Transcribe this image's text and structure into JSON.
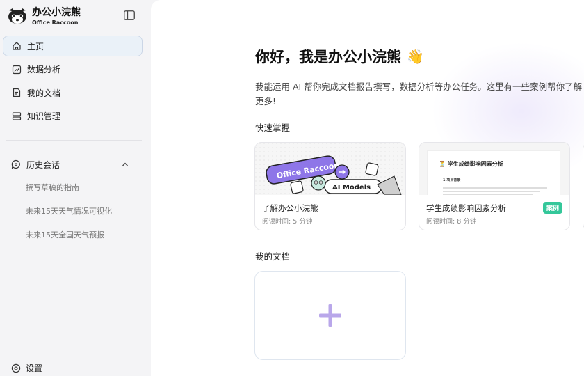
{
  "brand": {
    "title": "办公小浣熊",
    "subtitle": "Office Raccoon"
  },
  "nav": [
    {
      "label": "主页",
      "icon": "home-icon",
      "active": true
    },
    {
      "label": "数据分析",
      "icon": "chart-icon",
      "active": false
    },
    {
      "label": "我的文档",
      "icon": "document-icon",
      "active": false
    },
    {
      "label": "知识管理",
      "icon": "database-icon",
      "active": false
    }
  ],
  "history": {
    "label": "历史会话",
    "items": [
      "撰写草稿的指南",
      "未来15天天气情况可视化",
      "未来15天全国天气预报"
    ]
  },
  "settings_label": "设置",
  "main": {
    "greeting": "你好，我是办公小浣熊",
    "greeting_emoji": "👋",
    "intro": "我能运用 AI 帮你完成文档报告撰写，数据分析等办公任务。这里有一些案例帮你了解更多!",
    "quick_label": "快速掌握",
    "cards": [
      {
        "title": "了解办公小浣熊",
        "meta": "阅读时间: 5 分钟",
        "thumb_tag_1": "Office Raccoon",
        "thumb_tag_2": "AI Models"
      },
      {
        "title": "学生成绩影响因素分析",
        "meta": "阅读时间: 8 分钟",
        "badge": "案例",
        "thumb_heading": "学生成绩影响因素分析",
        "thumb_sub": "1.项目背景"
      }
    ],
    "docs_label": "我的文档"
  },
  "colors": {
    "accent_purple": "#9b87e6",
    "badge_green": "#34c79a",
    "active_nav_bg": "#eaf1f8"
  }
}
